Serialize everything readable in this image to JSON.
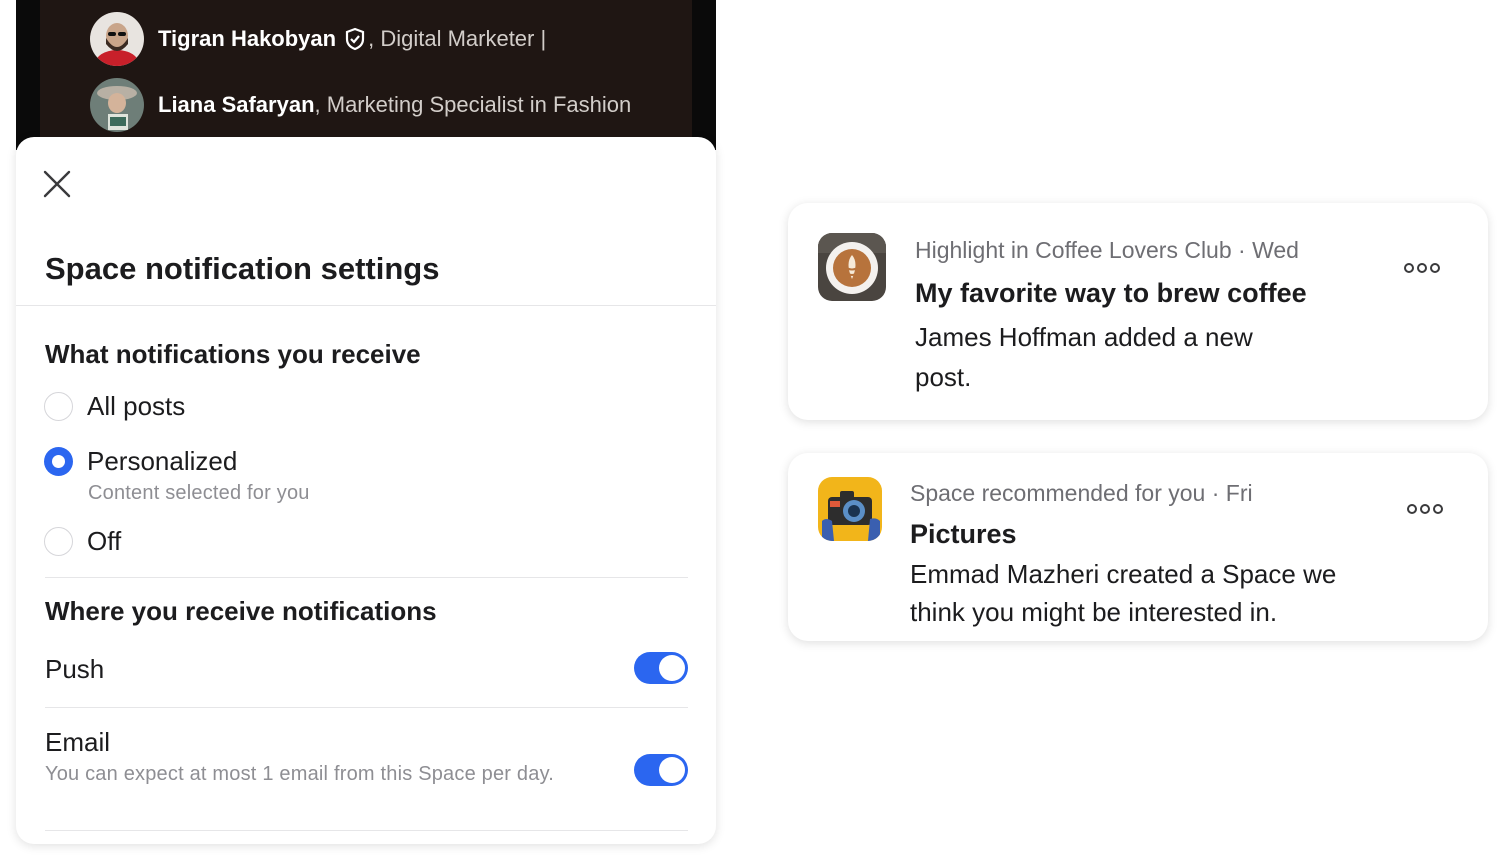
{
  "speakers": [
    {
      "name": "Tigran Hakobyan",
      "title": ", Digital Marketer |",
      "verified_icon": "shield-check-icon"
    },
    {
      "name": "Liana Safaryan",
      "title": ", Marketing Specialist in Fashion"
    }
  ],
  "sheet": {
    "close_icon": "close-icon",
    "title": "Space notification settings",
    "receive_section": {
      "heading": "What notifications you receive",
      "options": [
        {
          "label": "All posts",
          "selected": false
        },
        {
          "label": "Personalized",
          "sublabel": "Content selected for you",
          "selected": true
        },
        {
          "label": "Off",
          "selected": false
        }
      ]
    },
    "where_section": {
      "heading": "Where you receive notifications",
      "push": {
        "label": "Push",
        "enabled": true
      },
      "email": {
        "label": "Email",
        "sublabel": "You can expect at most 1 email from this Space per day.",
        "enabled": true
      }
    }
  },
  "notifications": [
    {
      "icon": "coffee-latte-icon",
      "meta": "Highlight in Coffee Lovers Club · Wed",
      "title": "My favorite way to brew coffee",
      "body": "James Hoffman added a new post.",
      "more_icon": "more-dots-icon"
    },
    {
      "icon": "camera-icon",
      "meta": "Space recommended for you · Fri",
      "title": "Pictures",
      "body": "Emmad Mazheri created a Space we think you might be interested in.",
      "more_icon": "more-dots-icon"
    }
  ],
  "colors": {
    "accent": "#2b66f0",
    "speaker_bg": "#1f1613",
    "secondary_text": "#8e8e93"
  }
}
